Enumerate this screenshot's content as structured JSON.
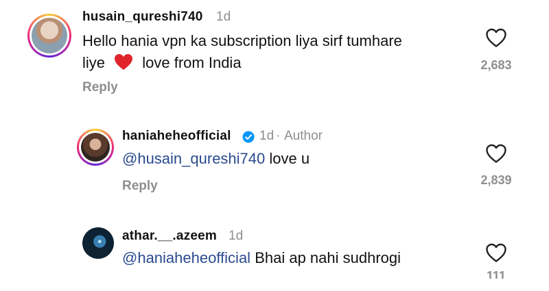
{
  "comments": [
    {
      "username": "husain_qureshi740",
      "time": "1d",
      "text_part1": "Hello hania vpn ka subscription liya sirf tumhare",
      "text_part2a": "liye",
      "text_part2b": "love from India",
      "likes": "2,683",
      "reply_label": "Reply"
    },
    {
      "username": "haniaheheofficial",
      "time": "1d",
      "separator": "·",
      "author_label": "Author",
      "mention": "@husain_qureshi740",
      "text": "love u",
      "likes": "2,839",
      "reply_label": "Reply"
    },
    {
      "username": "athar.__.azeem",
      "time": "1d",
      "mention": "@haniaheheofficial",
      "text": "Bhai ap nahi sudhrogi",
      "likes": "111"
    }
  ],
  "colors": {
    "mention": "#2a4a8f",
    "meta": "#8e8e8e",
    "verified": "#0095f6",
    "heart_emoji": "#e0242c"
  }
}
